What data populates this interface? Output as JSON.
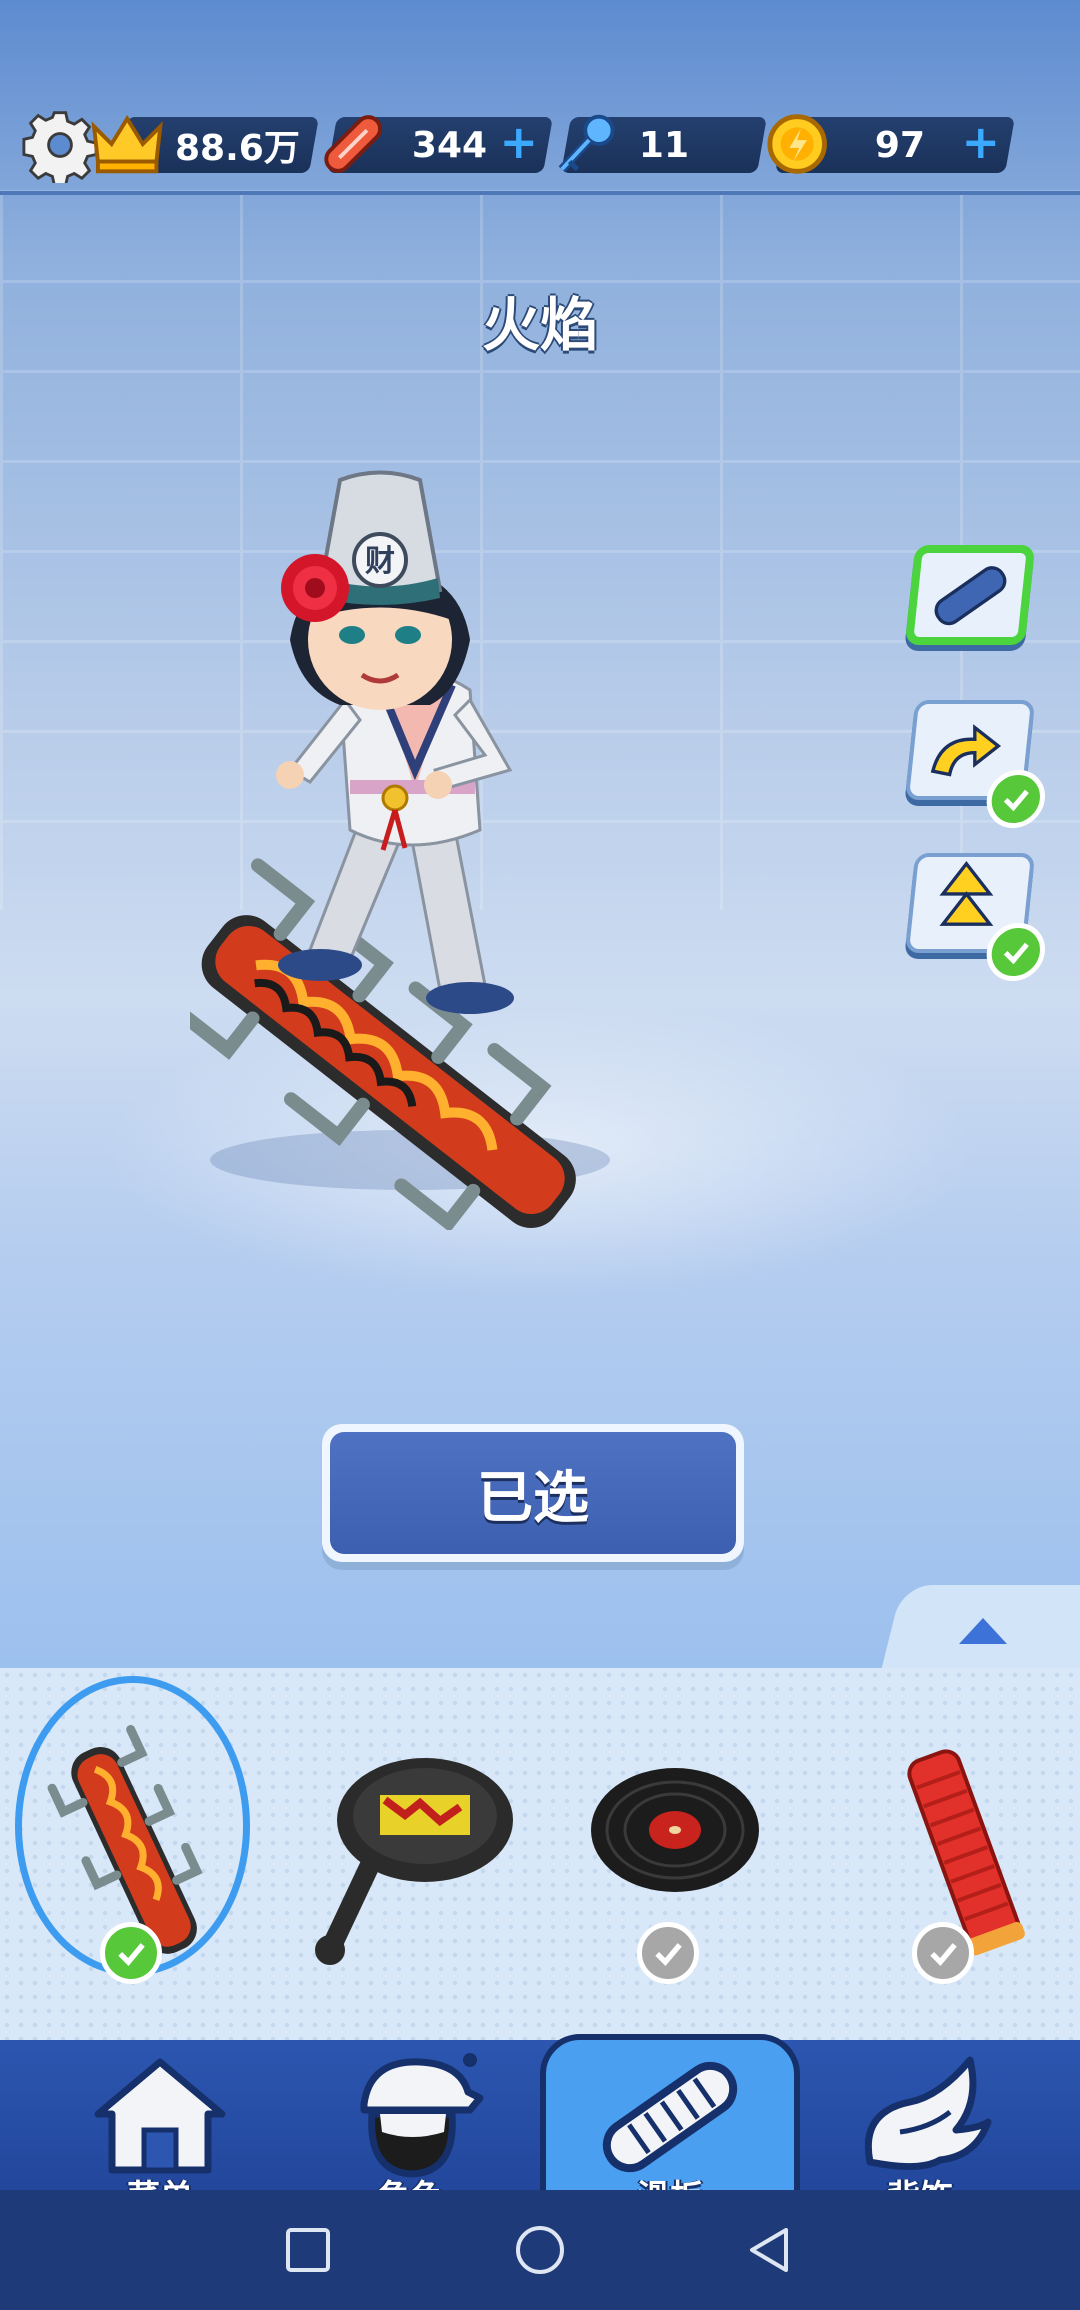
{
  "hud": {
    "crown_value": "88.6万",
    "boards_value": "344",
    "keys_value": "11",
    "coins_value": "97",
    "plus_label": "+"
  },
  "title": "火焰",
  "side_buttons": [
    {
      "name": "board",
      "active": true,
      "checked": false
    },
    {
      "name": "jump-upgrade",
      "active": false,
      "checked": true
    },
    {
      "name": "boost-upgrade",
      "active": false,
      "checked": true
    }
  ],
  "selected_button_label": "已选",
  "items": [
    {
      "name": "flame-board",
      "selected": true,
      "owned": true
    },
    {
      "name": "frying-pan-board",
      "selected": false,
      "owned": false
    },
    {
      "name": "vinyl-record-board",
      "selected": false,
      "owned": false
    },
    {
      "name": "red-board",
      "selected": false,
      "owned": false
    }
  ],
  "nav": {
    "menu": "菜单",
    "character": "角色",
    "board": "滑板",
    "accessory": "背饰",
    "active": "board"
  },
  "colors": {
    "accent_blue": "#3d5fb0",
    "check_green": "#58c83b",
    "active_border": "#4bd43d",
    "nav_bg": "#2c56b0"
  }
}
